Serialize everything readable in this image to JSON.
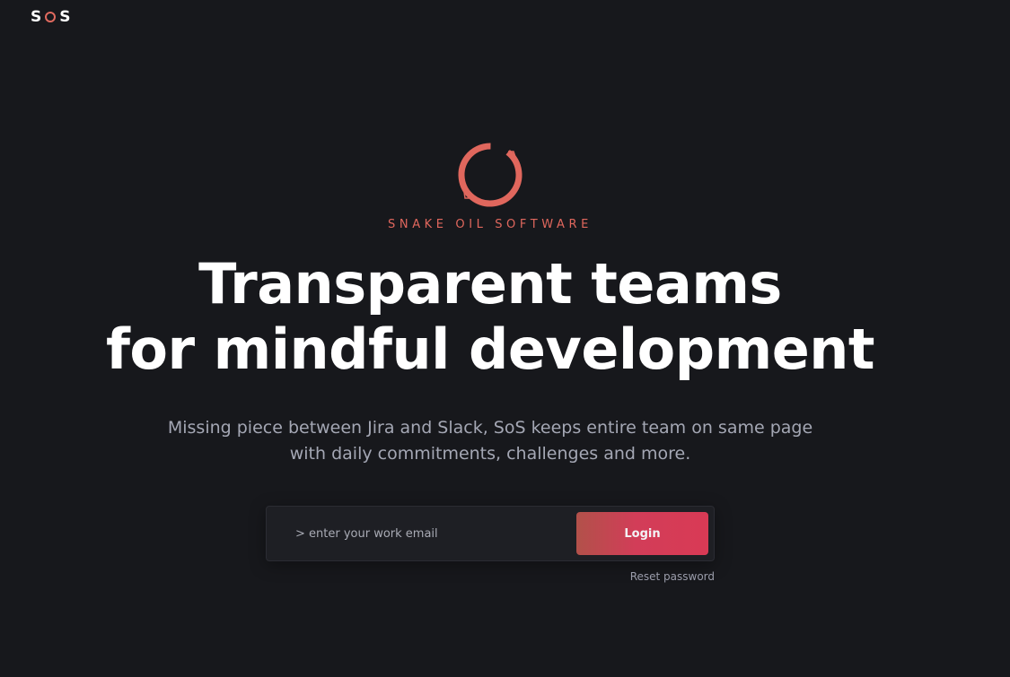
{
  "brand": {
    "logo_letter_left": "S",
    "logo_letter_right": "S",
    "tagline": "SNAKE OIL SOFTWARE",
    "accent_color": "#e0675d"
  },
  "hero": {
    "headline_line1": "Transparent teams",
    "headline_line2": "for mindful development",
    "subtitle_line1": "Missing piece between Jira and Slack, SoS keeps entire team on same page",
    "subtitle_line2": "with daily commitments, challenges and more."
  },
  "login": {
    "email_placeholder": "> enter your work email",
    "email_value": "",
    "button_label": "Login",
    "reset_label": "Reset password",
    "button_color": "#d93a55"
  }
}
